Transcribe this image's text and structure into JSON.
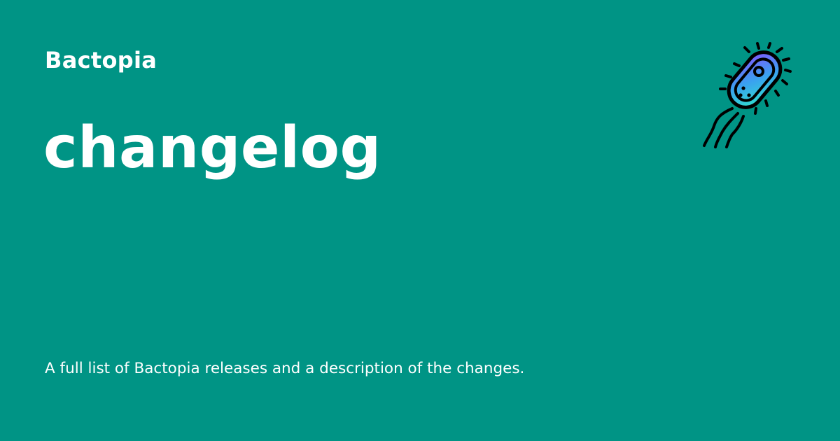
{
  "site": {
    "name": "Bactopia"
  },
  "page": {
    "title": "changelog",
    "description": "A full list of Bactopia releases and a description of the changes."
  },
  "logo": {
    "icon": "bacterium-icon",
    "gradient_start": "#8a4dff",
    "gradient_mid": "#3aa0f0",
    "gradient_end": "#2ee8c8"
  },
  "colors": {
    "background": "#009485",
    "text": "#ffffff"
  }
}
